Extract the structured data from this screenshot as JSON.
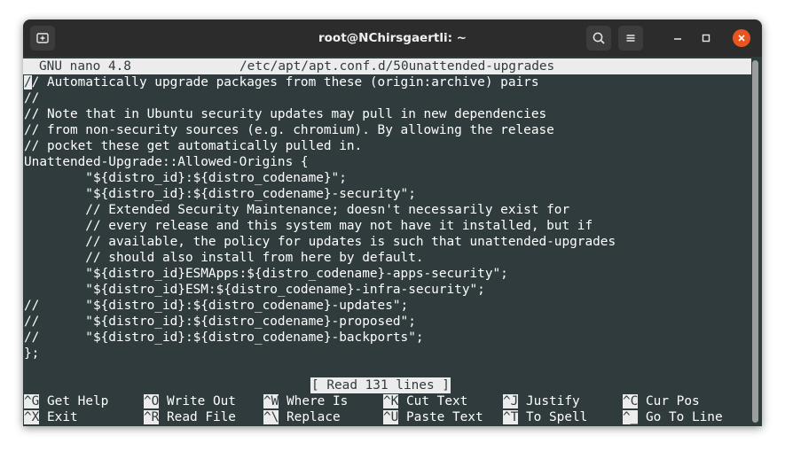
{
  "window": {
    "title": "root@NChirsgaertli: ~"
  },
  "nano": {
    "version": "GNU nano 4.8",
    "filename": "/etc/apt/apt.conf.d/50unattended-upgrades",
    "cursor_char": "/",
    "first_line_rest": "/ Automatically upgrade packages from these (origin:archive) pairs",
    "lines": [
      "//",
      "// Note that in Ubuntu security updates may pull in new dependencies",
      "// from non-security sources (e.g. chromium). By allowing the release",
      "// pocket these get automatically pulled in.",
      "Unattended-Upgrade::Allowed-Origins {",
      "        \"${distro_id}:${distro_codename}\";",
      "        \"${distro_id}:${distro_codename}-security\";",
      "        // Extended Security Maintenance; doesn't necessarily exist for",
      "        // every release and this system may not have it installed, but if",
      "        // available, the policy for updates is such that unattended-upgrades",
      "        // should also install from here by default.",
      "        \"${distro_id}ESMApps:${distro_codename}-apps-security\";",
      "        \"${distro_id}ESM:${distro_codename}-infra-security\";",
      "//      \"${distro_id}:${distro_codename}-updates\";",
      "//      \"${distro_id}:${distro_codename}-proposed\";",
      "//      \"${distro_id}:${distro_codename}-backports\";",
      "};"
    ],
    "status": "[ Read 131 lines ]",
    "shortcuts_row1": [
      {
        "key": "^G",
        "label": "Get Help"
      },
      {
        "key": "^O",
        "label": "Write Out"
      },
      {
        "key": "^W",
        "label": "Where Is"
      },
      {
        "key": "^K",
        "label": "Cut Text"
      },
      {
        "key": "^J",
        "label": "Justify"
      },
      {
        "key": "^C",
        "label": "Cur Pos"
      }
    ],
    "shortcuts_row2": [
      {
        "key": "^X",
        "label": "Exit"
      },
      {
        "key": "^R",
        "label": "Read File"
      },
      {
        "key": "^\\",
        "label": "Replace"
      },
      {
        "key": "^U",
        "label": "Paste Text"
      },
      {
        "key": "^T",
        "label": "To Spell"
      },
      {
        "key": "^_",
        "label": "Go To Line"
      }
    ]
  },
  "colors": {
    "terminal_bg": "#2f3b3d",
    "titlebar_bg": "#2c2c2c",
    "close_button": "#e95420",
    "highlight_bg": "#ececec"
  },
  "icons": {
    "new_tab": "new-tab-icon",
    "search": "search-icon",
    "menu": "hamburger-menu-icon",
    "minimize": "minimize-icon",
    "maximize": "maximize-icon",
    "close": "close-icon"
  }
}
